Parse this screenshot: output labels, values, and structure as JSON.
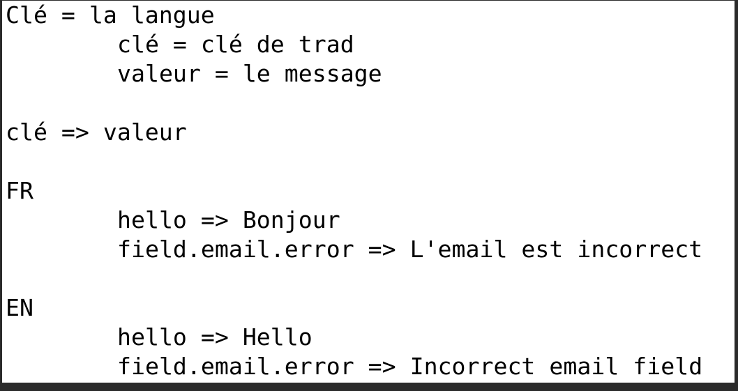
{
  "lines": [
    {
      "text": "Clé = la langue",
      "indent": false
    },
    {
      "text": "clé = clé de trad",
      "indent": true
    },
    {
      "text": "valeur = le message",
      "indent": true
    },
    {
      "text": "",
      "indent": false
    },
    {
      "text": "clé => valeur",
      "indent": false
    },
    {
      "text": "",
      "indent": false
    },
    {
      "text": "FR",
      "indent": false
    },
    {
      "text": "hello => Bonjour",
      "indent": true
    },
    {
      "text": "field.email.error => L'email est incorrect",
      "indent": true
    },
    {
      "text": "",
      "indent": false
    },
    {
      "text": "EN",
      "indent": false
    },
    {
      "text": "hello => Hello",
      "indent": true
    },
    {
      "text": "field.email.error => Incorrect email field",
      "indent": true
    }
  ]
}
